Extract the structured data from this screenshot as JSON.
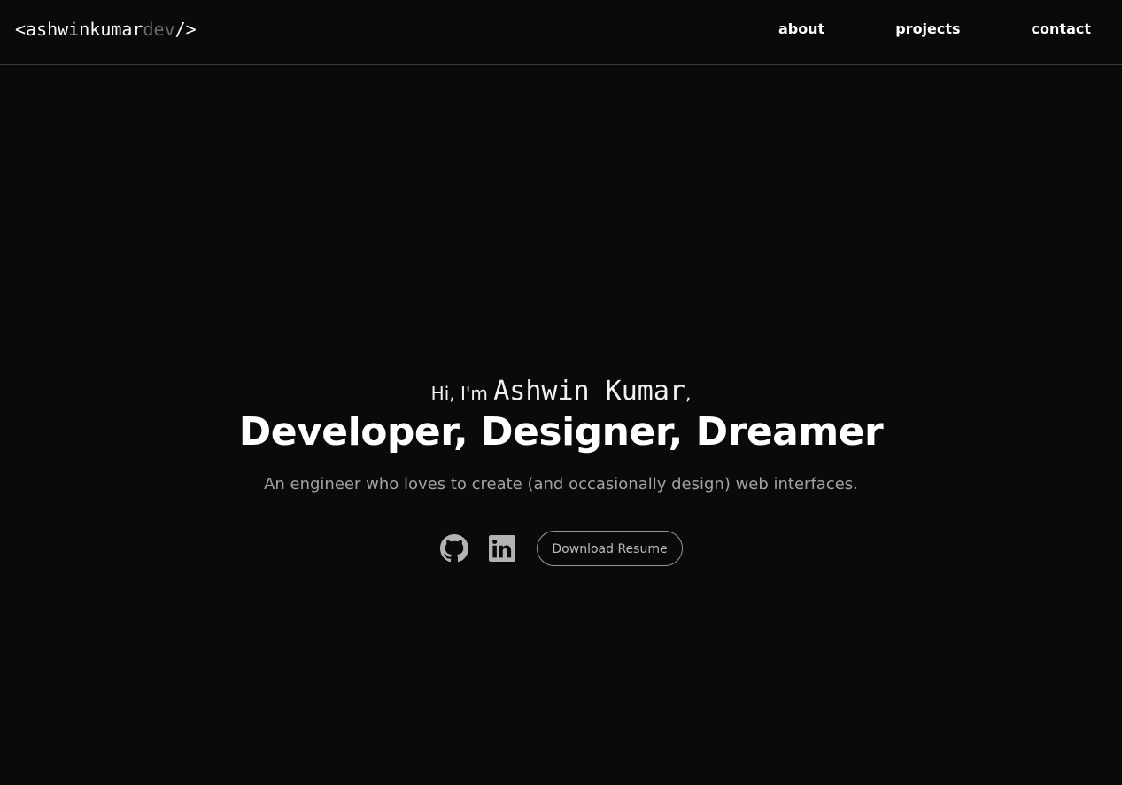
{
  "nav": {
    "logo": {
      "prefix": "<ashwinkumar",
      "dim": "dev",
      "suffix": "/>"
    },
    "links": [
      {
        "label": "about"
      },
      {
        "label": "projects"
      },
      {
        "label": "contact"
      }
    ]
  },
  "hero": {
    "greeting_prefix": "Hi, I'm ",
    "name": "Ashwin Kumar",
    "greeting_suffix": ",",
    "headline": "Developer, Designer, Dreamer",
    "subtitle": "An engineer who loves to create (and occasionally design) web interfaces.",
    "social": [
      {
        "icon": "github-icon"
      },
      {
        "icon": "linkedin-icon"
      }
    ],
    "resume_label": "Download Resume"
  },
  "colors": {
    "background": "#0a0a0a",
    "text": "#ffffff",
    "muted": "#a3a3a3",
    "dim_logo": "#6b6b6b",
    "icon": "#b3b3b3"
  }
}
